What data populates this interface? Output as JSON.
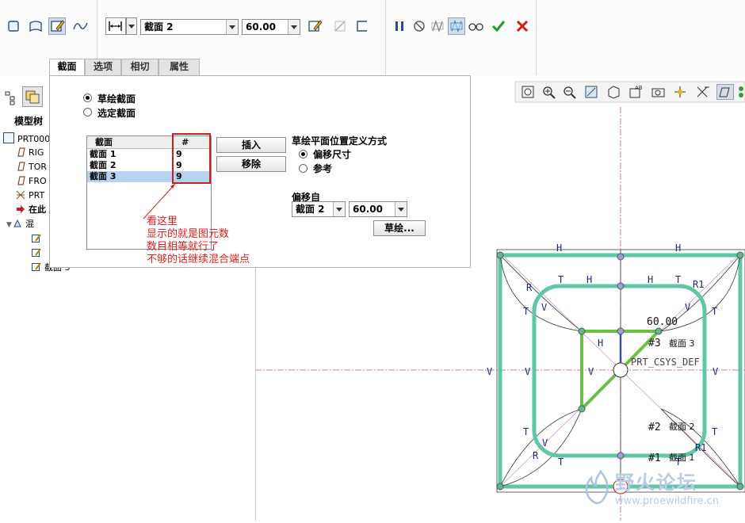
{
  "toolbar": {
    "section_combo": "截面 2",
    "depth_combo": "60.00"
  },
  "tabs": [
    "截面",
    "选项",
    "相切",
    "属性"
  ],
  "tree": {
    "title": "模型树",
    "items": [
      "PRT000",
      "RIG",
      "TOR",
      "FRO",
      "PRT",
      "在此",
      "混",
      "",
      "",
      "截面 3"
    ]
  },
  "panel": {
    "radio_sketched": "草绘截面",
    "radio_selected": "选定截面",
    "table_headers": [
      "截面",
      "#"
    ],
    "table_rows": [
      {
        "name": "截面 1",
        "count": "9"
      },
      {
        "name": "截面 2",
        "count": "9"
      },
      {
        "name": "截面 3",
        "count": "9"
      }
    ],
    "insert_button": "插入",
    "remove_button": "移除",
    "placement_title": "草绘平面位置定义方式",
    "radio_offset": "偏移尺寸",
    "radio_reference": "参考",
    "offset_from_label": "偏移自",
    "offset_section": "截面 2",
    "offset_value": "60.00",
    "sketch_button": "草绘..."
  },
  "annotation": {
    "lines": [
      "看这里",
      "显示的就是图元数",
      "数目相等就行了",
      "不够的话继续混合端点"
    ]
  },
  "sketch": {
    "dim_value": "60.00",
    "csys_label": "PRT_CSYS_DEF",
    "sec3_label": "截面 3",
    "sec2_label": "截面 2",
    "sec1_label": "截面 1",
    "marker1": "#1",
    "marker2": "#2",
    "marker3": "#3",
    "c_H": "H",
    "c_V": "V",
    "c_T": "T",
    "c_R": "R",
    "c_R1": "R1"
  },
  "watermark": {
    "brand": "野火论坛",
    "url": "www.proewildfire.cn"
  }
}
